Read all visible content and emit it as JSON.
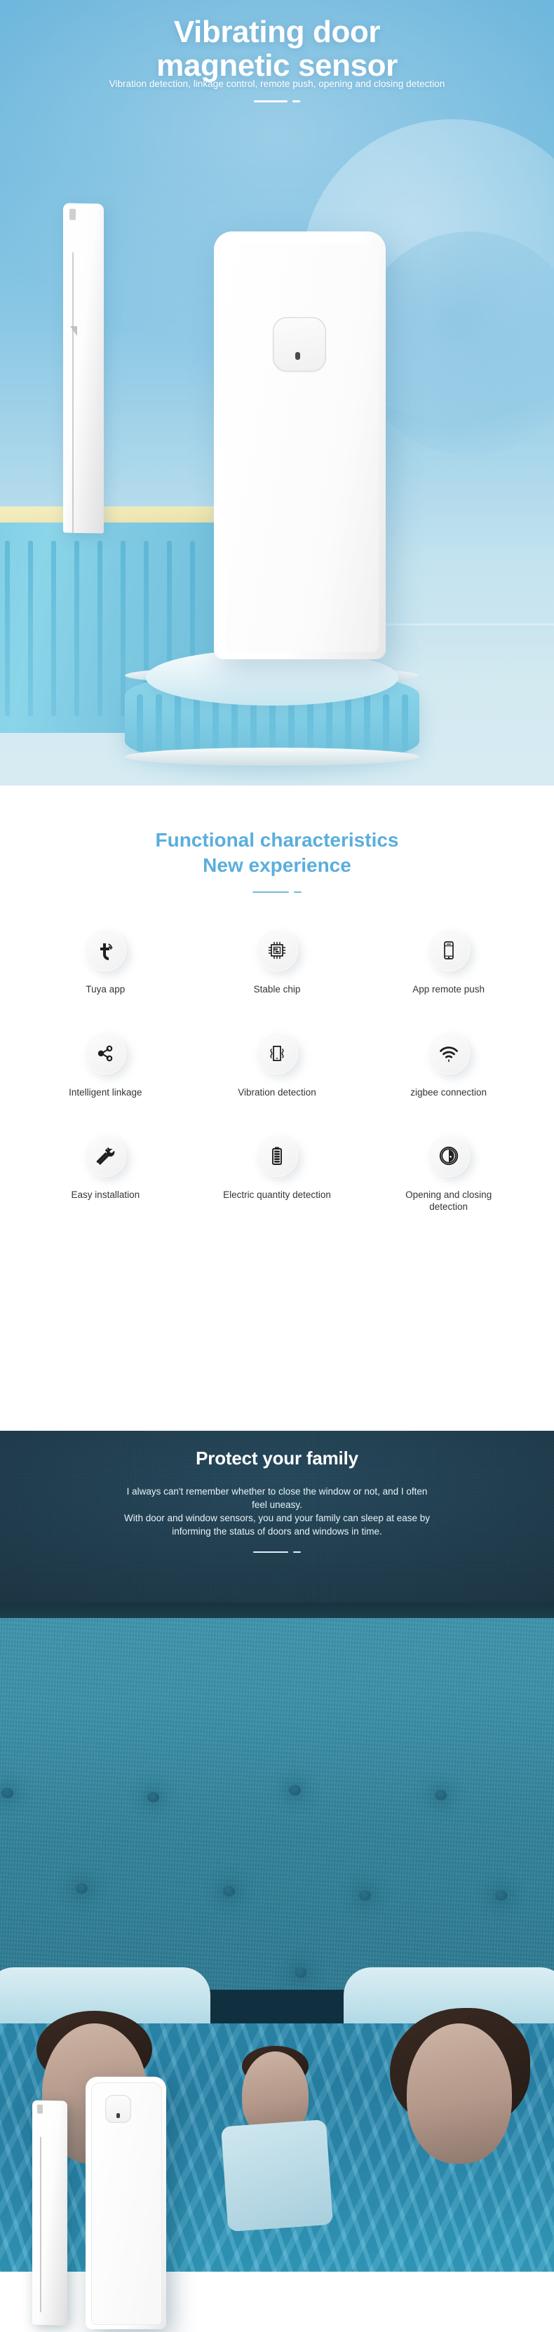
{
  "hero": {
    "title_line1": "Vibrating door",
    "title_line2": "magnetic sensor",
    "subtitle": "Vibration detection, linkage control, remote push, opening and closing detection",
    "bg_color_top": "#6fb7dd",
    "bg_color_bottom": "#d2e9f1",
    "title_color": "#ffffff"
  },
  "features": {
    "heading_line1": "Functional characteristics",
    "heading_line2": "New experience",
    "heading_color": "#5aaedd",
    "items": [
      {
        "icon": "tuya-app-icon",
        "label": "Tuya app"
      },
      {
        "icon": "chip-icon",
        "label": "Stable chip"
      },
      {
        "icon": "phone-push-icon",
        "label": "App remote push"
      },
      {
        "icon": "share-network-icon",
        "label": "Intelligent linkage"
      },
      {
        "icon": "vibration-icon",
        "label": "Vibration detection"
      },
      {
        "icon": "wifi-icon",
        "label": "zigbee connection"
      },
      {
        "icon": "screwdriver-wrench-icon",
        "label": "Easy installation"
      },
      {
        "icon": "battery-icon",
        "label": "Electric quantity detection"
      },
      {
        "icon": "door-open-close-icon",
        "label": "Opening and closing detection"
      }
    ]
  },
  "protect": {
    "title": "Protect your family",
    "paragraph_line1": "I always can't remember whether to close the window or not, and I often",
    "paragraph_line2": "feel uneasy.",
    "paragraph_line3": "With door and window sensors, you and your family can sleep at ease by",
    "paragraph_line4": "informing the status of doors and windows in time.",
    "bg_color": "#1e3b4c",
    "text_color": "#e9f2f6"
  }
}
